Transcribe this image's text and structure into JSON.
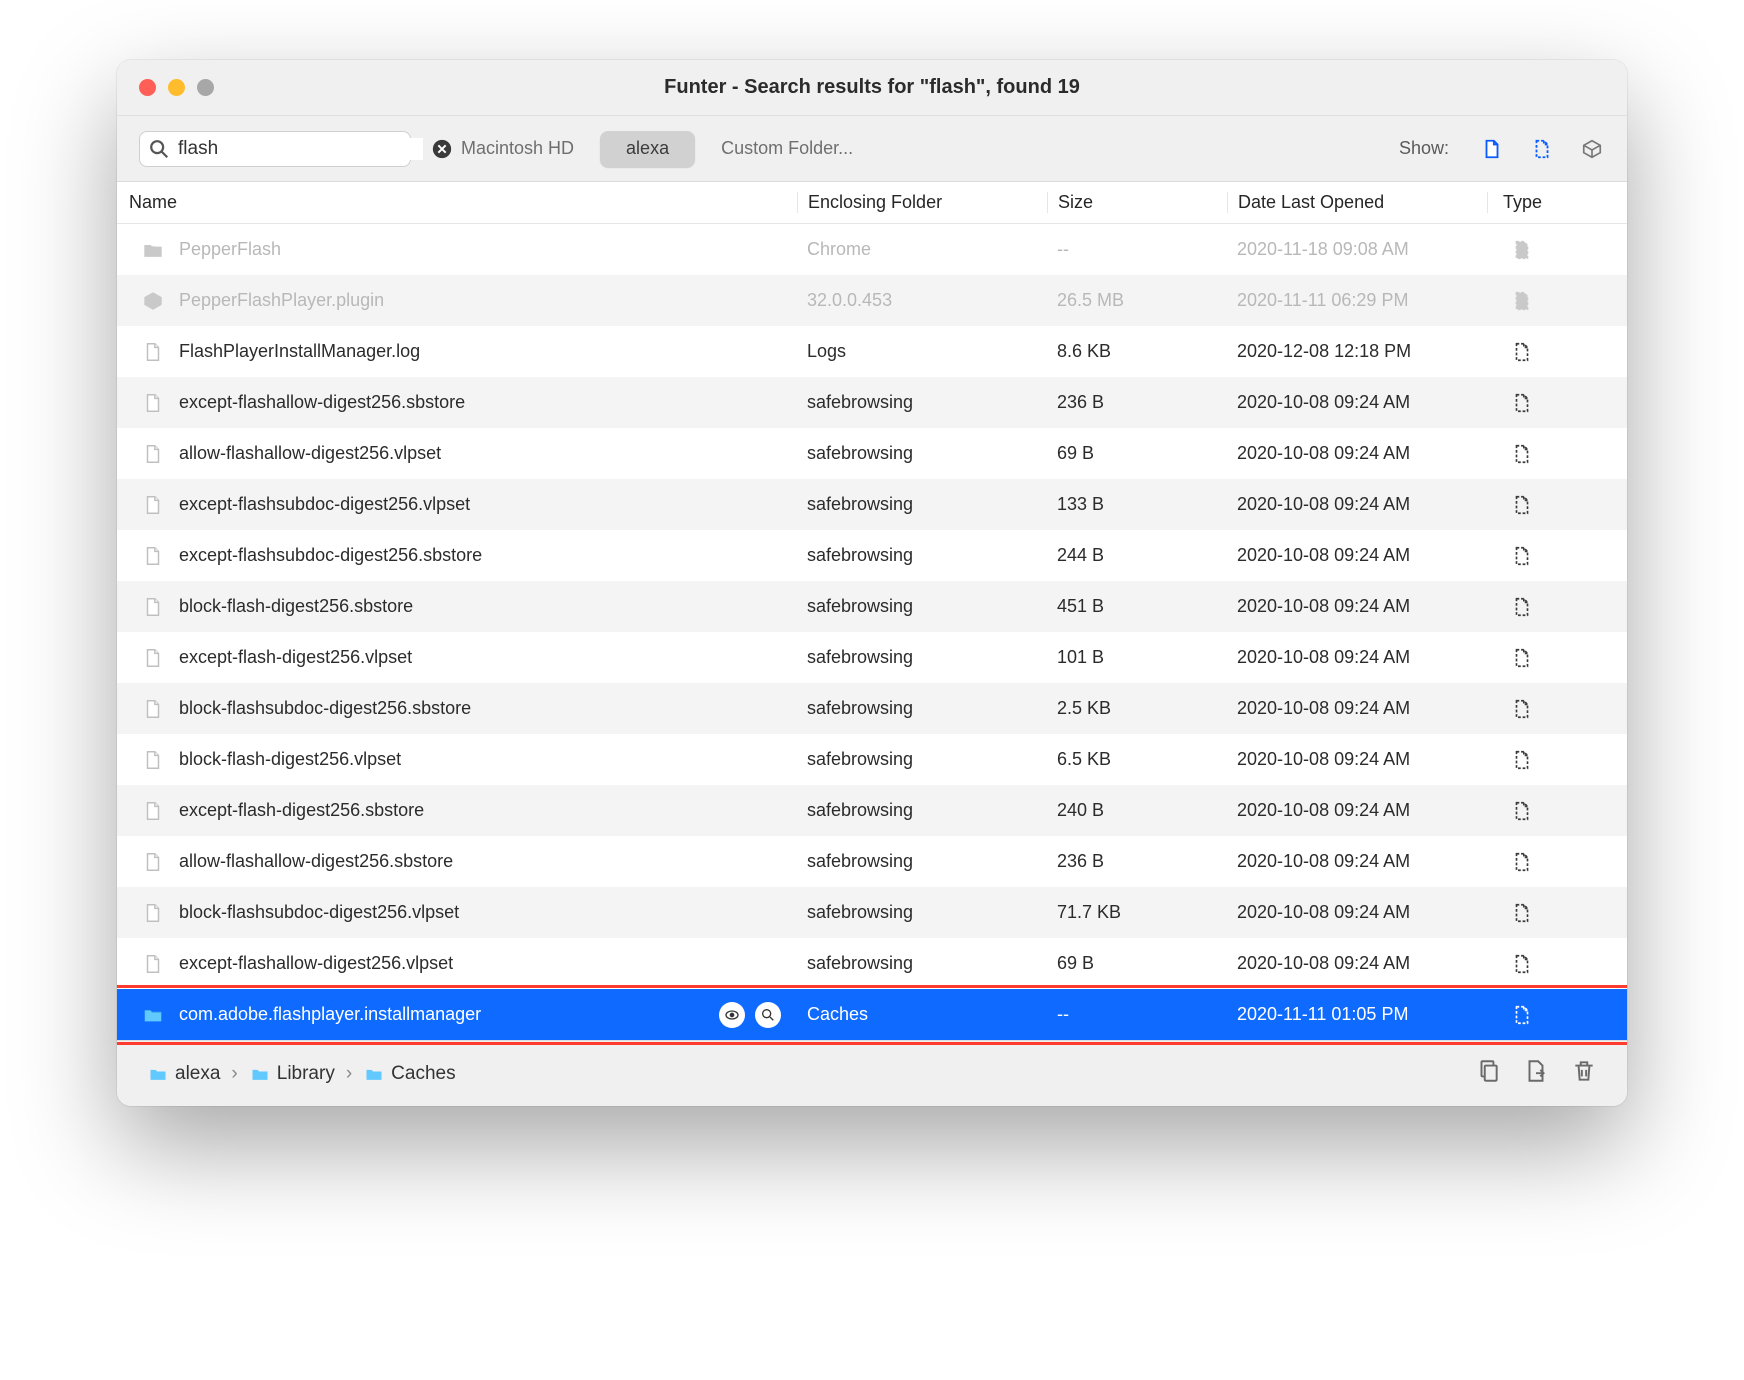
{
  "window": {
    "title": "Funter - Search results for \"flash\", found 19"
  },
  "search": {
    "value": "flash"
  },
  "scopes": {
    "items": [
      "Macintosh HD",
      "alexa",
      "Custom Folder..."
    ],
    "active_index": 1
  },
  "show_label": "Show:",
  "columns": {
    "name": "Name",
    "folder": "Enclosing Folder",
    "size": "Size",
    "date": "Date Last Opened",
    "type": "Type"
  },
  "rows": [
    {
      "icon": "folder",
      "name": "PepperFlash",
      "folder": "Chrome",
      "size": "--",
      "date": "2020-11-18 09:08 AM",
      "type": "hidden",
      "faded": true
    },
    {
      "icon": "plugin",
      "name": "PepperFlashPlayer.plugin",
      "folder": "32.0.0.453",
      "size": "26.5 MB",
      "date": "2020-11-11 06:29 PM",
      "type": "hidden",
      "faded": true
    },
    {
      "icon": "doc",
      "name": "FlashPlayerInstallManager.log",
      "folder": "Logs",
      "size": "8.6 KB",
      "date": "2020-12-08 12:18 PM",
      "type": "hidden"
    },
    {
      "icon": "doc",
      "name": "except-flashallow-digest256.sbstore",
      "folder": "safebrowsing",
      "size": "236 B",
      "date": "2020-10-08 09:24 AM",
      "type": "hidden"
    },
    {
      "icon": "doc",
      "name": "allow-flashallow-digest256.vlpset",
      "folder": "safebrowsing",
      "size": "69 B",
      "date": "2020-10-08 09:24 AM",
      "type": "hidden"
    },
    {
      "icon": "doc",
      "name": "except-flashsubdoc-digest256.vlpset",
      "folder": "safebrowsing",
      "size": "133 B",
      "date": "2020-10-08 09:24 AM",
      "type": "hidden"
    },
    {
      "icon": "doc",
      "name": "except-flashsubdoc-digest256.sbstore",
      "folder": "safebrowsing",
      "size": "244 B",
      "date": "2020-10-08 09:24 AM",
      "type": "hidden"
    },
    {
      "icon": "doc",
      "name": "block-flash-digest256.sbstore",
      "folder": "safebrowsing",
      "size": "451 B",
      "date": "2020-10-08 09:24 AM",
      "type": "hidden"
    },
    {
      "icon": "doc",
      "name": "except-flash-digest256.vlpset",
      "folder": "safebrowsing",
      "size": "101 B",
      "date": "2020-10-08 09:24 AM",
      "type": "hidden"
    },
    {
      "icon": "doc",
      "name": "block-flashsubdoc-digest256.sbstore",
      "folder": "safebrowsing",
      "size": "2.5 KB",
      "date": "2020-10-08 09:24 AM",
      "type": "hidden"
    },
    {
      "icon": "doc",
      "name": "block-flash-digest256.vlpset",
      "folder": "safebrowsing",
      "size": "6.5 KB",
      "date": "2020-10-08 09:24 AM",
      "type": "hidden"
    },
    {
      "icon": "doc",
      "name": "except-flash-digest256.sbstore",
      "folder": "safebrowsing",
      "size": "240 B",
      "date": "2020-10-08 09:24 AM",
      "type": "hidden"
    },
    {
      "icon": "doc",
      "name": "allow-flashallow-digest256.sbstore",
      "folder": "safebrowsing",
      "size": "236 B",
      "date": "2020-10-08 09:24 AM",
      "type": "hidden"
    },
    {
      "icon": "doc",
      "name": "block-flashsubdoc-digest256.vlpset",
      "folder": "safebrowsing",
      "size": "71.7 KB",
      "date": "2020-10-08 09:24 AM",
      "type": "hidden"
    },
    {
      "icon": "doc",
      "name": "except-flashallow-digest256.vlpset",
      "folder": "safebrowsing",
      "size": "69 B",
      "date": "2020-10-08 09:24 AM",
      "type": "hidden"
    },
    {
      "icon": "folder",
      "name": "com.adobe.flashplayer.installmanager",
      "folder": "Caches",
      "size": "--",
      "date": "2020-11-11 01:05 PM",
      "type": "hidden",
      "selected": true
    }
  ],
  "breadcrumb": [
    "alexa",
    "Library",
    "Caches"
  ]
}
